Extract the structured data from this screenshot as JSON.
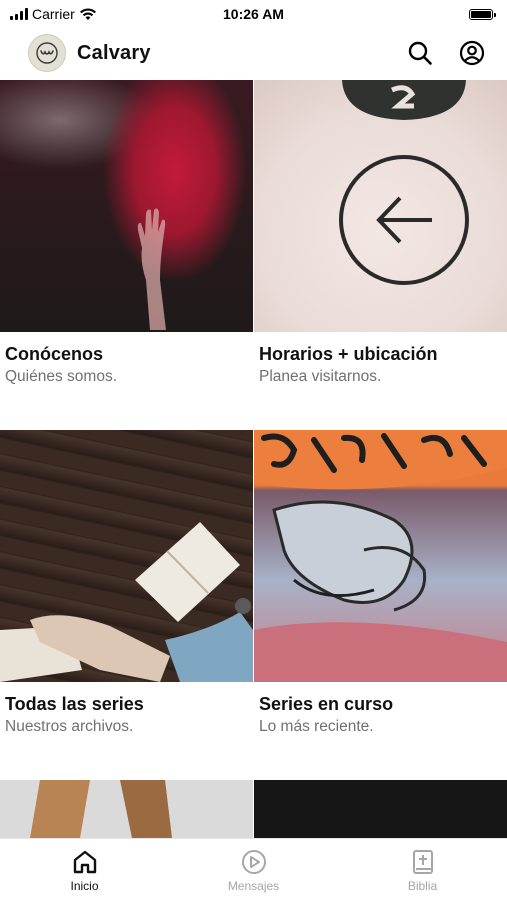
{
  "status_bar": {
    "carrier": "Carrier",
    "time": "10:26 AM"
  },
  "header": {
    "title": "Calvary",
    "logo_icon": "calvary-logo-icon",
    "search_icon": "search-icon",
    "profile_icon": "profile-icon"
  },
  "cards": [
    {
      "title": "Conócenos",
      "subtitle": "Quiénes somos."
    },
    {
      "title": "Horarios + ubicación",
      "subtitle": "Planea visitarnos."
    },
    {
      "title": "Todas las series",
      "subtitle": "Nuestros archivos."
    },
    {
      "title": "Series en curso",
      "subtitle": "Lo más reciente."
    }
  ],
  "tabs": [
    {
      "label": "Inicio",
      "icon": "home-icon",
      "active": true
    },
    {
      "label": "Mensajes",
      "icon": "play-circle-icon",
      "active": false
    },
    {
      "label": "Biblia",
      "icon": "bible-icon",
      "active": false
    }
  ],
  "colors": {
    "text_primary": "#111111",
    "text_secondary": "#707070",
    "tab_inactive": "#a6a6a6",
    "logo_background": "#e4e0d4"
  }
}
